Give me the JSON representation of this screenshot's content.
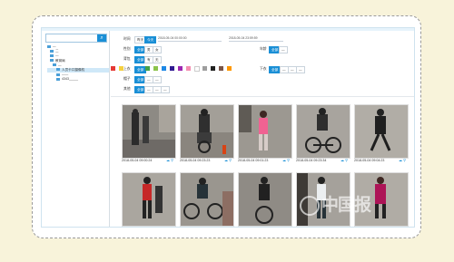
{
  "search": {
    "placeholder": "",
    "button_icon": "search-icon"
  },
  "tree": [
    {
      "label": "—",
      "level": 0
    },
    {
      "label": "二",
      "level": 1
    },
    {
      "label": "—",
      "level": 1
    },
    {
      "label": "教育局",
      "level": 1
    },
    {
      "label": "—",
      "level": 2
    },
    {
      "label": "人员卡口摄像机",
      "level": 3
    },
    {
      "label": "——",
      "level": 3
    },
    {
      "label": "4343_____",
      "level": 3
    }
  ],
  "filters": {
    "time": {
      "label": "时间",
      "options": [
        "昨天",
        "今天"
      ],
      "start": "2018-05-04 00:00:00",
      "end": "2018-05-04 23:59:59"
    },
    "gender": {
      "label": "性别",
      "options": [
        "全部",
        "男",
        "女"
      ],
      "side_label": "年龄",
      "side_options": [
        "全部",
        "—"
      ]
    },
    "bag": {
      "label": "背包",
      "options": [
        "全部",
        "有",
        "无"
      ]
    },
    "color_label": "上衣",
    "colors": [
      "#e53935",
      "#f4d03f",
      "#43a047",
      "#8bc34a",
      "#1e88e5",
      "#311b92",
      "#9c27b0",
      "#f48fb1",
      "#ffffff",
      "#9e9e9e",
      "#212121",
      "#795548",
      "#ff9800"
    ],
    "pants_label": "下衣",
    "hat": {
      "label": "帽子",
      "options": [
        "全部",
        "—",
        "—"
      ]
    },
    "more": {
      "label": "其他",
      "options": [
        "全部",
        "—",
        "—",
        "—"
      ]
    }
  },
  "results": [
    {
      "time": "2018-05-04 09:00:24"
    },
    {
      "time": "2018-05-04 09:23:23"
    },
    {
      "time": "2018-05-04 09:01:23"
    },
    {
      "time": "2018-05-04 09:23:34"
    },
    {
      "time": "2018-05-04 09:04:23"
    },
    {
      "time": ""
    },
    {
      "time": ""
    },
    {
      "time": ""
    },
    {
      "time": ""
    },
    {
      "time": ""
    }
  ],
  "watermark": "中国报"
}
